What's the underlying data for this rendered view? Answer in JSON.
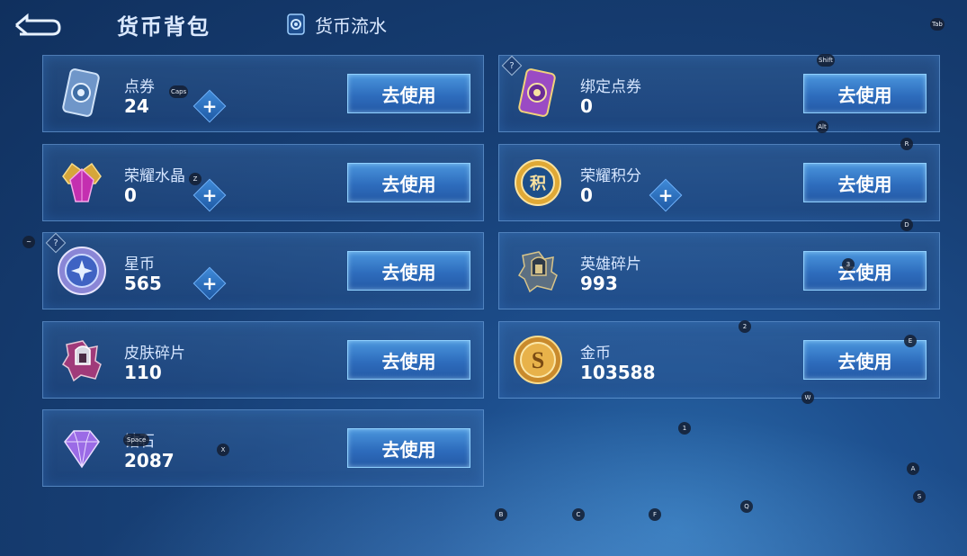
{
  "header": {
    "title": "货币背包",
    "flow_tab": "货币流水"
  },
  "currencies": [
    {
      "name": "点券",
      "amount": "24",
      "button": "去使用",
      "has_plus": true,
      "has_help": false,
      "icon": "voucher-card-icon"
    },
    {
      "name": "绑定点券",
      "amount": "0",
      "button": "去使用",
      "has_plus": false,
      "has_help": true,
      "icon": "bound-voucher-card-icon"
    },
    {
      "name": "荣耀水晶",
      "amount": "0",
      "button": "去使用",
      "has_plus": true,
      "has_help": false,
      "icon": "glory-crystal-icon"
    },
    {
      "name": "荣耀积分",
      "amount": "0",
      "button": "去使用",
      "has_plus": true,
      "has_help": false,
      "icon": "glory-points-icon"
    },
    {
      "name": "星币",
      "amount": "565",
      "button": "去使用",
      "has_plus": true,
      "has_help": true,
      "icon": "star-coin-icon"
    },
    {
      "name": "英雄碎片",
      "amount": "993",
      "button": "去使用",
      "has_plus": false,
      "has_help": false,
      "icon": "hero-fragment-icon"
    },
    {
      "name": "皮肤碎片",
      "amount": "110",
      "button": "去使用",
      "has_plus": false,
      "has_help": false,
      "icon": "skin-fragment-icon"
    },
    {
      "name": "金币",
      "amount": "103588",
      "button": "去使用",
      "has_plus": false,
      "has_help": false,
      "icon": "gold-coin-icon"
    },
    {
      "name": "钻石",
      "amount": "2087",
      "button": "去使用",
      "has_plus": false,
      "has_help": false,
      "icon": "diamond-icon"
    }
  ],
  "help_symbol": "?",
  "plus_symbol": "+",
  "key_hints": {
    "tab": "Tab",
    "shift": "Shift",
    "alt": "Alt",
    "caps": "Caps",
    "r": "R",
    "z": "Z",
    "d": "D",
    "tilde": "~",
    "three": "3",
    "two": "2",
    "e": "E",
    "w": "W",
    "one": "1",
    "x": "X",
    "space": "Space",
    "a": "A",
    "s": "S",
    "q": "Q",
    "b": "B",
    "c": "C",
    "f": "F"
  },
  "colors": {
    "background": "#173f75",
    "button": "#2e6dbd",
    "card_border": "#78afeb"
  }
}
